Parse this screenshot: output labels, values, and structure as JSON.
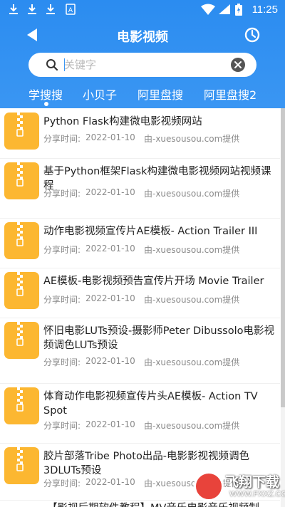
{
  "status_bar": {
    "time": "11:25",
    "icons": [
      "download-icon",
      "download-icon",
      "download-icon",
      "a-badge-icon",
      "wifi-icon",
      "signal-icon",
      "battery-icon"
    ]
  },
  "header": {
    "title": "电影视频",
    "back_icon": "back-arrow-icon",
    "history_icon": "clock-icon",
    "background_color": "#2b8cf0"
  },
  "search": {
    "placeholder": "关键字",
    "value": "",
    "search_icon": "search-icon",
    "clear_icon": "clear-icon"
  },
  "tabs": [
    {
      "label": "学搜搜",
      "active": true
    },
    {
      "label": "小贝子",
      "active": false
    },
    {
      "label": "阿里盘搜",
      "active": false
    },
    {
      "label": "阿里盘搜2",
      "active": false
    }
  ],
  "results": [
    {
      "title": "Python Flask构建微电影视频网站",
      "share_label": "分享时间:",
      "date": "2022-01-10",
      "source": "由-xuesousou.com提供"
    },
    {
      "title": "基于Python框架Flask构建微电影视频网站视频课程",
      "share_label": "分享时间:",
      "date": "2022-01-10",
      "source": "由-xuesousou.com提供"
    },
    {
      "title": "动作电影视频宣传片AE模板- Action Trailer III",
      "share_label": "分享时间:",
      "date": "2022-01-10",
      "source": "由-xuesousou.com提供"
    },
    {
      "title": "AE模板-电影视频预告宣传片开场 Movie Trailer",
      "share_label": "分享时间:",
      "date": "2022-01-10",
      "source": "由-xuesousou.com提供"
    },
    {
      "title": "怀旧电影LUTs预设-摄影师Peter Dibussolo电影视频调色LUTs预设",
      "share_label": "分享时间:",
      "date": "2022-01-10",
      "source": "由-xuesousou.com提供"
    },
    {
      "title": "体育动作电影视频宣传片头AE模板- Action TV Spot",
      "share_label": "分享时间:",
      "date": "2022-01-10",
      "source": "由-xuesousou.com提供"
    },
    {
      "title": "胶片部落Tribe Photo出品-电影影视视频调色3DLUTs预设",
      "share_label": "分享时间:",
      "date": "2022-01-10",
      "source": "由-xuesousou.com提供"
    },
    {
      "title": "【影视后期软件教程】MV音乐电影音乐视频制",
      "share_label": "",
      "date": "",
      "source": ""
    }
  ],
  "watermark": {
    "text": "飞翔下载",
    "sub": "WWW.FXXZ.COM"
  },
  "colors": {
    "accent": "#3a96f3",
    "zip_icon": "#fcb731",
    "meta_text": "#8a8a8a"
  }
}
